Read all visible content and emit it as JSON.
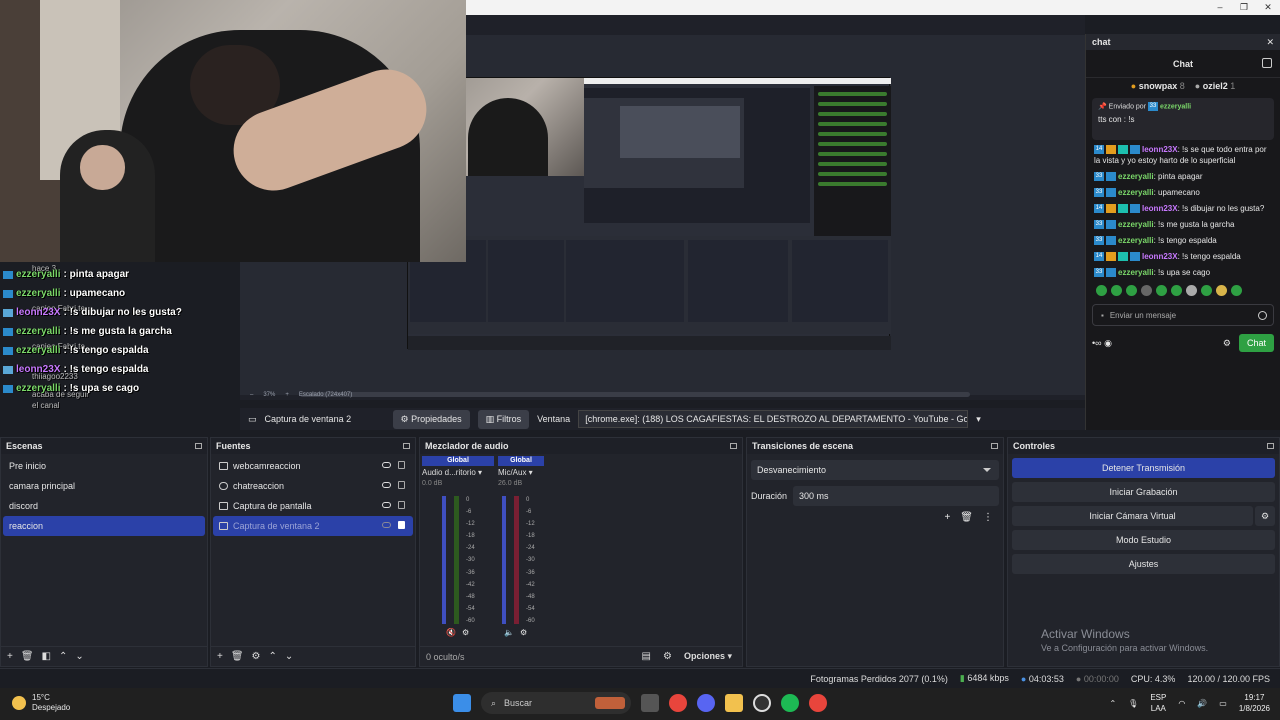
{
  "window": {
    "controls": [
      "–",
      "❐",
      "✕"
    ]
  },
  "chat_overlay_left": {
    "lines": [
      {
        "user": "ezzeryalli",
        "text": ": pinta apagar",
        "color": "green"
      },
      {
        "user": "ezzeryalli",
        "text": ": upamecano",
        "color": "green"
      },
      {
        "user": "leonn23X",
        "text": ": !s dibujar no les gusta?",
        "color": "purple"
      },
      {
        "user": "ezzeryalli",
        "text": ": !s me gusta la garcha",
        "color": "green"
      },
      {
        "user": "ezzeryalli",
        "text": ": !s tengo espalda",
        "color": "green"
      },
      {
        "user": "leonn23X",
        "text": ": !s tengo espalda",
        "color": "purple"
      },
      {
        "user": "ezzeryalli",
        "text": ": !s upa se cago",
        "color": "green"
      }
    ],
    "ghost": [
      "hace 3",
      "canjeo Fabri te",
      "hace 1",
      "canjeo Fabri te",
      "thiiagoo2233",
      "acaba de seguir",
      "el canal"
    ]
  },
  "preview": {
    "zoom": "37%",
    "scaling": "Escalado (724x407)"
  },
  "source_toolbar": {
    "source_name": "Captura de ventana 2",
    "properties": "Propiedades",
    "filters": "Filtros",
    "window_label": "Ventana",
    "window_value": "[chrome.exe]: (188) LOS CAGAFIESTAS: EL DESTROZO AL DEPARTAMENTO - YouTube - Google C"
  },
  "chat_dock": {
    "dock_title": "chat",
    "header": "Chat",
    "leaders": [
      {
        "name": "snowpax",
        "count": "8"
      },
      {
        "name": "oziel2",
        "count": "1"
      }
    ],
    "pinned": {
      "label": "Enviado por",
      "user": "ezzeryalli",
      "message": "tts con : !s"
    },
    "messages": [
      {
        "badges": [
          "14",
          "o",
          "t",
          "b"
        ],
        "user": "leonn23X",
        "text": ": !s se que todo entra por la vista y yo estoy harto de lo superficial",
        "color": "purple"
      },
      {
        "badges": [
          "33",
          "b"
        ],
        "user": "ezzeryalli",
        "text": ": pinta apagar",
        "color": "green"
      },
      {
        "badges": [
          "33",
          "b"
        ],
        "user": "ezzeryalli",
        "text": ": upamecano",
        "color": "green"
      },
      {
        "badges": [
          "14",
          "o",
          "t",
          "b"
        ],
        "user": "leonn23X",
        "text": ": !s dibujar no les gusta?",
        "color": "purple"
      },
      {
        "badges": [
          "33",
          "b"
        ],
        "user": "ezzeryalli",
        "text": ": !s me gusta la garcha",
        "color": "green"
      },
      {
        "badges": [
          "33",
          "b"
        ],
        "user": "ezzeryalli",
        "text": ": !s tengo espalda",
        "color": "green"
      },
      {
        "badges": [
          "14",
          "o",
          "t",
          "b"
        ],
        "user": "leonn23X",
        "text": ": !s tengo espalda",
        "color": "purple"
      },
      {
        "badges": [
          "33",
          "b"
        ],
        "user": "ezzeryalli",
        "text": ": !s upa se cago",
        "color": "green"
      }
    ],
    "input_placeholder": "Enviar un mensaje",
    "chat_button": "Chat"
  },
  "scenes": {
    "title": "Escenas",
    "items": [
      "Pre inicio",
      "camara principal",
      "discord",
      "reaccion"
    ],
    "selected": 3
  },
  "sources": {
    "title": "Fuentes",
    "items": [
      "webcamreaccion",
      "chatreaccion",
      "Captura de pantalla",
      "Captura de ventana 2"
    ]
  },
  "mixer": {
    "title": "Mezclador de audio",
    "channels": [
      {
        "badge": "Global",
        "name": "Audio d...ritorio",
        "db": "0.0 dB"
      },
      {
        "badge": "Global",
        "name": "Mic/Aux",
        "db": "26.0 dB"
      }
    ],
    "ticks": [
      "0",
      "-6",
      "-12",
      "-18",
      "-24",
      "-30",
      "-36",
      "-42",
      "-48",
      "-54",
      "-60"
    ],
    "hidden_count": "0 oculto/s",
    "options": "Opciones"
  },
  "transitions": {
    "title": "Transiciones de escena",
    "selected": "Desvanecimiento",
    "duration_label": "Duración",
    "duration_value": "300 ms"
  },
  "controls": {
    "title": "Controles",
    "buttons": [
      "Detener Transmisión",
      "Iniciar Grabación",
      "Iniciar Cámara Virtual",
      "Modo Estudio",
      "Ajustes"
    ]
  },
  "watermark": {
    "line1": "Activar Windows",
    "line2": "Ve a Configuración para activar Windows."
  },
  "status": {
    "frames": "Fotogramas Perdidos 2077 (0.1%)",
    "bitrate": "6484 kbps",
    "live_time": "04:03:53",
    "rec_time": "00:00:00",
    "cpu": "CPU: 4.3%",
    "fps": "120.00 / 120.00 FPS"
  },
  "taskbar": {
    "temp": "15°C",
    "weather": "Despejado",
    "search": "Buscar",
    "lang1": "ESP",
    "lang2": "LAA",
    "time": "19:17",
    "date": "1/8/2026"
  },
  "colors": {
    "accent": "#2b41a8",
    "chat_green": "#2ea043",
    "name_green": "#7bd86a",
    "name_purple": "#c879ff"
  }
}
